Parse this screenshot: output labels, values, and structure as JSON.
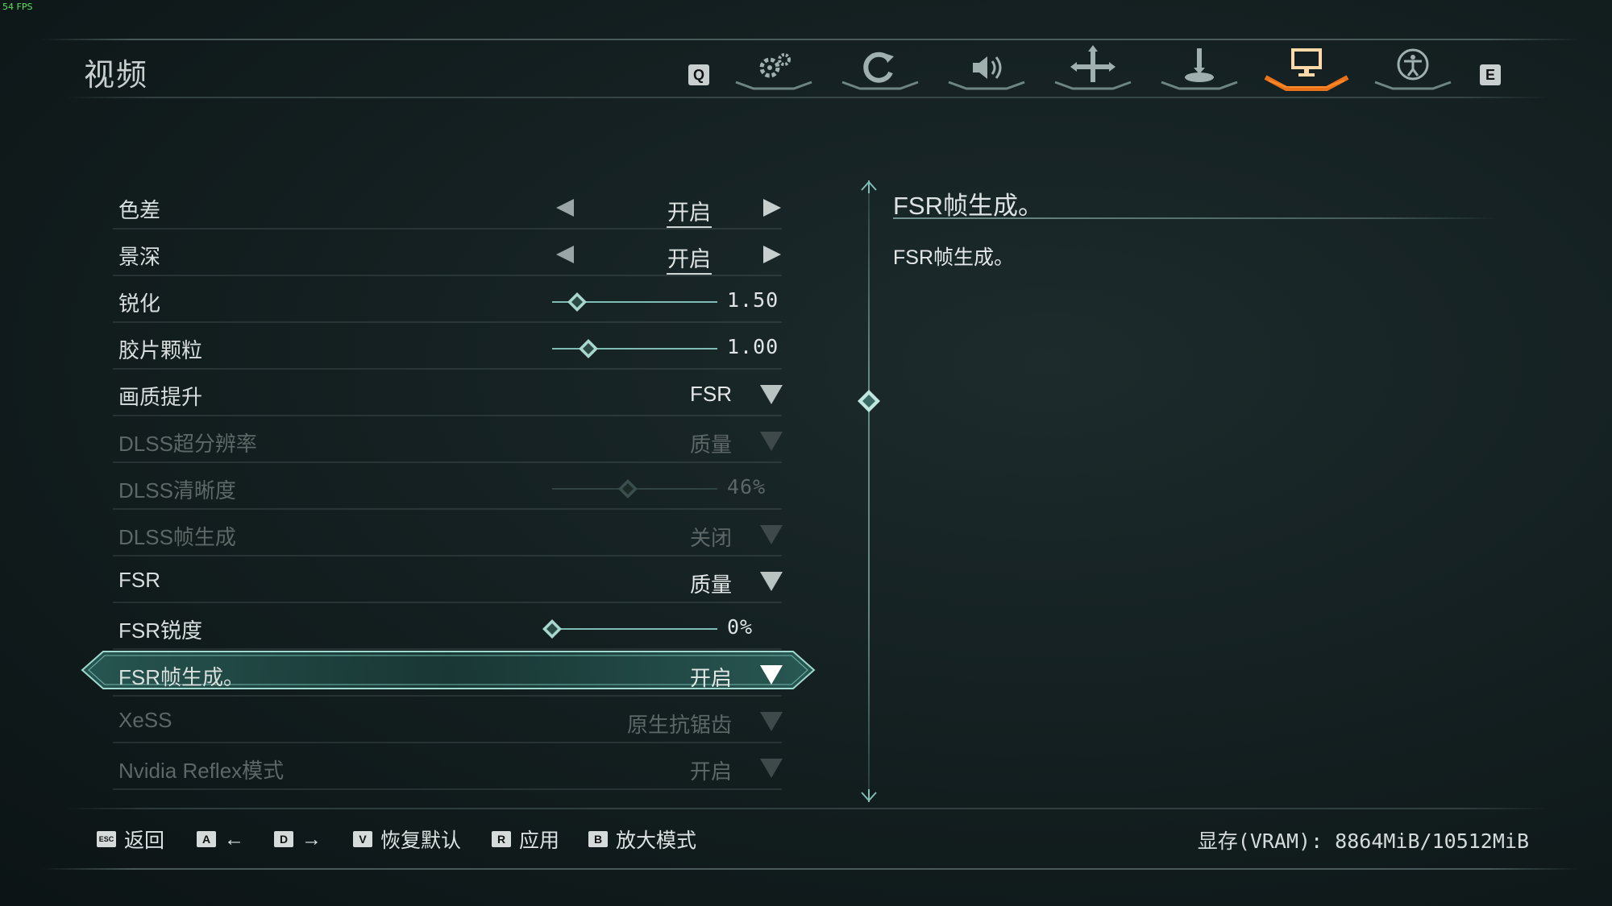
{
  "overlay": {
    "fps": "54 FPS"
  },
  "header": {
    "title": "视频",
    "prev_key": "Q",
    "next_key": "E",
    "tabs": [
      {
        "icon": "gear-icon",
        "active": false
      },
      {
        "icon": "camera-rotate-icon",
        "active": false
      },
      {
        "icon": "speaker-icon",
        "active": false
      },
      {
        "icon": "crosshair-move-icon",
        "active": false
      },
      {
        "icon": "joystick-icon",
        "active": false
      },
      {
        "icon": "monitor-icon",
        "active": true
      },
      {
        "icon": "accessibility-icon",
        "active": false
      }
    ],
    "accent_active": "#ff8a2a"
  },
  "settings": {
    "rows": [
      {
        "label": "色差",
        "type": "toggle",
        "value": "开启",
        "enabled": true
      },
      {
        "label": "景深",
        "type": "toggle",
        "value": "开启",
        "enabled": true
      },
      {
        "label": "锐化",
        "type": "slider",
        "value": "1.50",
        "level": 0.15,
        "enabled": true
      },
      {
        "label": "胶片颗粒",
        "type": "slider",
        "value": "1.00",
        "level": 0.22,
        "enabled": true
      },
      {
        "label": "画质提升",
        "type": "dropdown",
        "value": "FSR",
        "enabled": true
      },
      {
        "label": "DLSS超分辨率",
        "type": "dropdown",
        "value": "质量",
        "enabled": false
      },
      {
        "label": "DLSS清晰度",
        "type": "slider",
        "value": "46%",
        "level": 0.46,
        "enabled": false
      },
      {
        "label": "DLSS帧生成",
        "type": "dropdown",
        "value": "关闭",
        "enabled": false
      },
      {
        "label": "FSR",
        "type": "dropdown",
        "value": "质量",
        "enabled": true
      },
      {
        "label": "FSR锐度",
        "type": "slider",
        "value": "0%",
        "level": 0.0,
        "enabled": true
      },
      {
        "label": "FSR帧生成。",
        "type": "dropdown",
        "value": "开启",
        "enabled": true,
        "selected": true
      },
      {
        "label": "XeSS",
        "type": "dropdown",
        "value": "原生抗锯齿",
        "enabled": false
      },
      {
        "label": "Nvidia Reflex模式",
        "type": "dropdown",
        "value": "开启",
        "enabled": false
      }
    ]
  },
  "description": {
    "title": "FSR帧生成。",
    "body": "FSR帧生成。"
  },
  "footer": {
    "items": [
      {
        "key": "ESC",
        "label": "返回"
      },
      {
        "key": "A",
        "label": "←"
      },
      {
        "key": "D",
        "label": "→"
      },
      {
        "key": "V",
        "label": "恢复默认"
      },
      {
        "key": "R",
        "label": "应用"
      },
      {
        "key": "B",
        "label": "放大模式"
      }
    ],
    "vram": "显存(VRAM): 8864MiB/10512MiB"
  }
}
